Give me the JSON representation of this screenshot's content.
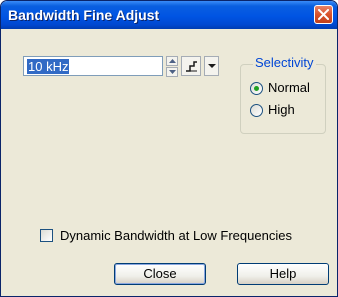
{
  "window": {
    "title": "Bandwidth Fine Adjust",
    "close_icon": "close-x-icon"
  },
  "frequency": {
    "value": "10 kHz",
    "spinner_icons": [
      "spin-up-icon",
      "spin-down-icon"
    ],
    "tool_icon": "step-icon",
    "dropdown_icon": "chevron-down-icon"
  },
  "selectivity": {
    "legend": "Selectivity",
    "options": [
      {
        "label": "Normal",
        "selected": true
      },
      {
        "label": "High",
        "selected": false
      }
    ]
  },
  "dynamic_bandwidth": {
    "label": "Dynamic Bandwidth at Low Frequencies",
    "checked": false
  },
  "buttons": {
    "close_label": "Close",
    "help_label": "Help"
  },
  "colors": {
    "title_bar": "#0054e3",
    "dialog_bg": "#ece9d8",
    "selection": "#316ac5",
    "group_legend": "#0046d5",
    "radio_dot": "#21a121",
    "close_button": "#d9532b"
  }
}
